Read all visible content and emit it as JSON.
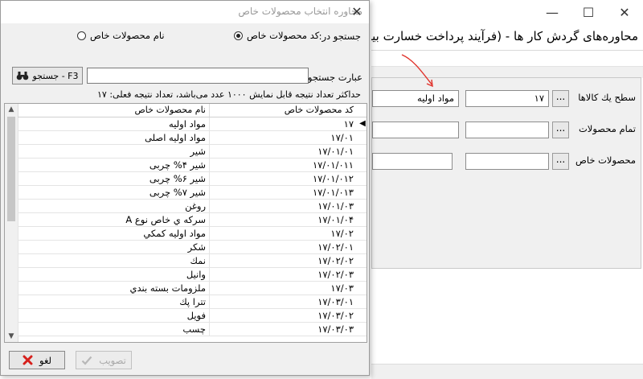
{
  "background_window": {
    "heading": "محاوره‌های گردش کار ها - (فرآیند پرداخت خسارت بیمه(ت",
    "fields": [
      {
        "label": "سطح یك كالاها",
        "code": "۱۷",
        "name": "مواد اولیه"
      },
      {
        "label": "تمام محصولات",
        "code": "",
        "name": ""
      },
      {
        "label": "محصولات خاص",
        "code": "",
        "name": ""
      }
    ],
    "dots_label": "...",
    "window_buttons": {
      "minimize": "—",
      "maximize": "☐",
      "close": "✕"
    },
    "accent_color": "#e0312a"
  },
  "dialog": {
    "title": "محاوره انتخاب محصولات خاص",
    "close_glyph": "✕",
    "search_in_label": "جستجو در:",
    "radio_code": "كد محصولات خاص",
    "radio_name": "نام محصولات خاص",
    "search_phrase_label": "عبارت جستجو",
    "search_input_value": "",
    "search_button": "جستجو - F3",
    "info_line": "حداكثر تعداد نتیجه قابل نمایش ۱۰۰۰ عدد می‌باشد، تعداد نتیجه فعلی: ۱۷",
    "columns": {
      "code": "كد محصولات خاص",
      "name": "نام محصولات خاص"
    },
    "rows": [
      {
        "code": "۱۷",
        "name": "مواد اولیه"
      },
      {
        "code": "۱۷/۰۱",
        "name": "مواد اولیه اصلی"
      },
      {
        "code": "۱۷/۰۱/۰۱",
        "name": "شیر"
      },
      {
        "code": "۱۷/۰۱/۰۱۱",
        "name": "شیر ۴% چربی"
      },
      {
        "code": "۱۷/۰۱/۰۱۲",
        "name": "شیر ۶% چربی"
      },
      {
        "code": "۱۷/۰۱/۰۱۳",
        "name": "شیر ۷% چربی"
      },
      {
        "code": "۱۷/۰۱/۰۳",
        "name": "روغن"
      },
      {
        "code": "۱۷/۰۱/۰۴",
        "name": "سركه ي خاص نوع A"
      },
      {
        "code": "۱۷/۰۲",
        "name": "مواد اولیه كمكي"
      },
      {
        "code": "۱۷/۰۲/۰۱",
        "name": "شكر"
      },
      {
        "code": "۱۷/۰۲/۰۲",
        "name": "نمك"
      },
      {
        "code": "۱۷/۰۲/۰۳",
        "name": "وانیل"
      },
      {
        "code": "۱۷/۰۳",
        "name": "ملزومات بسته بندي"
      },
      {
        "code": "۱۷/۰۳/۰۱",
        "name": "تترا پك"
      },
      {
        "code": "۱۷/۰۳/۰۲",
        "name": "فويل"
      },
      {
        "code": "۱۷/۰۳/۰۳",
        "name": "چسب"
      }
    ],
    "cancel_button": "لغو",
    "ok_button": "تصویب"
  }
}
